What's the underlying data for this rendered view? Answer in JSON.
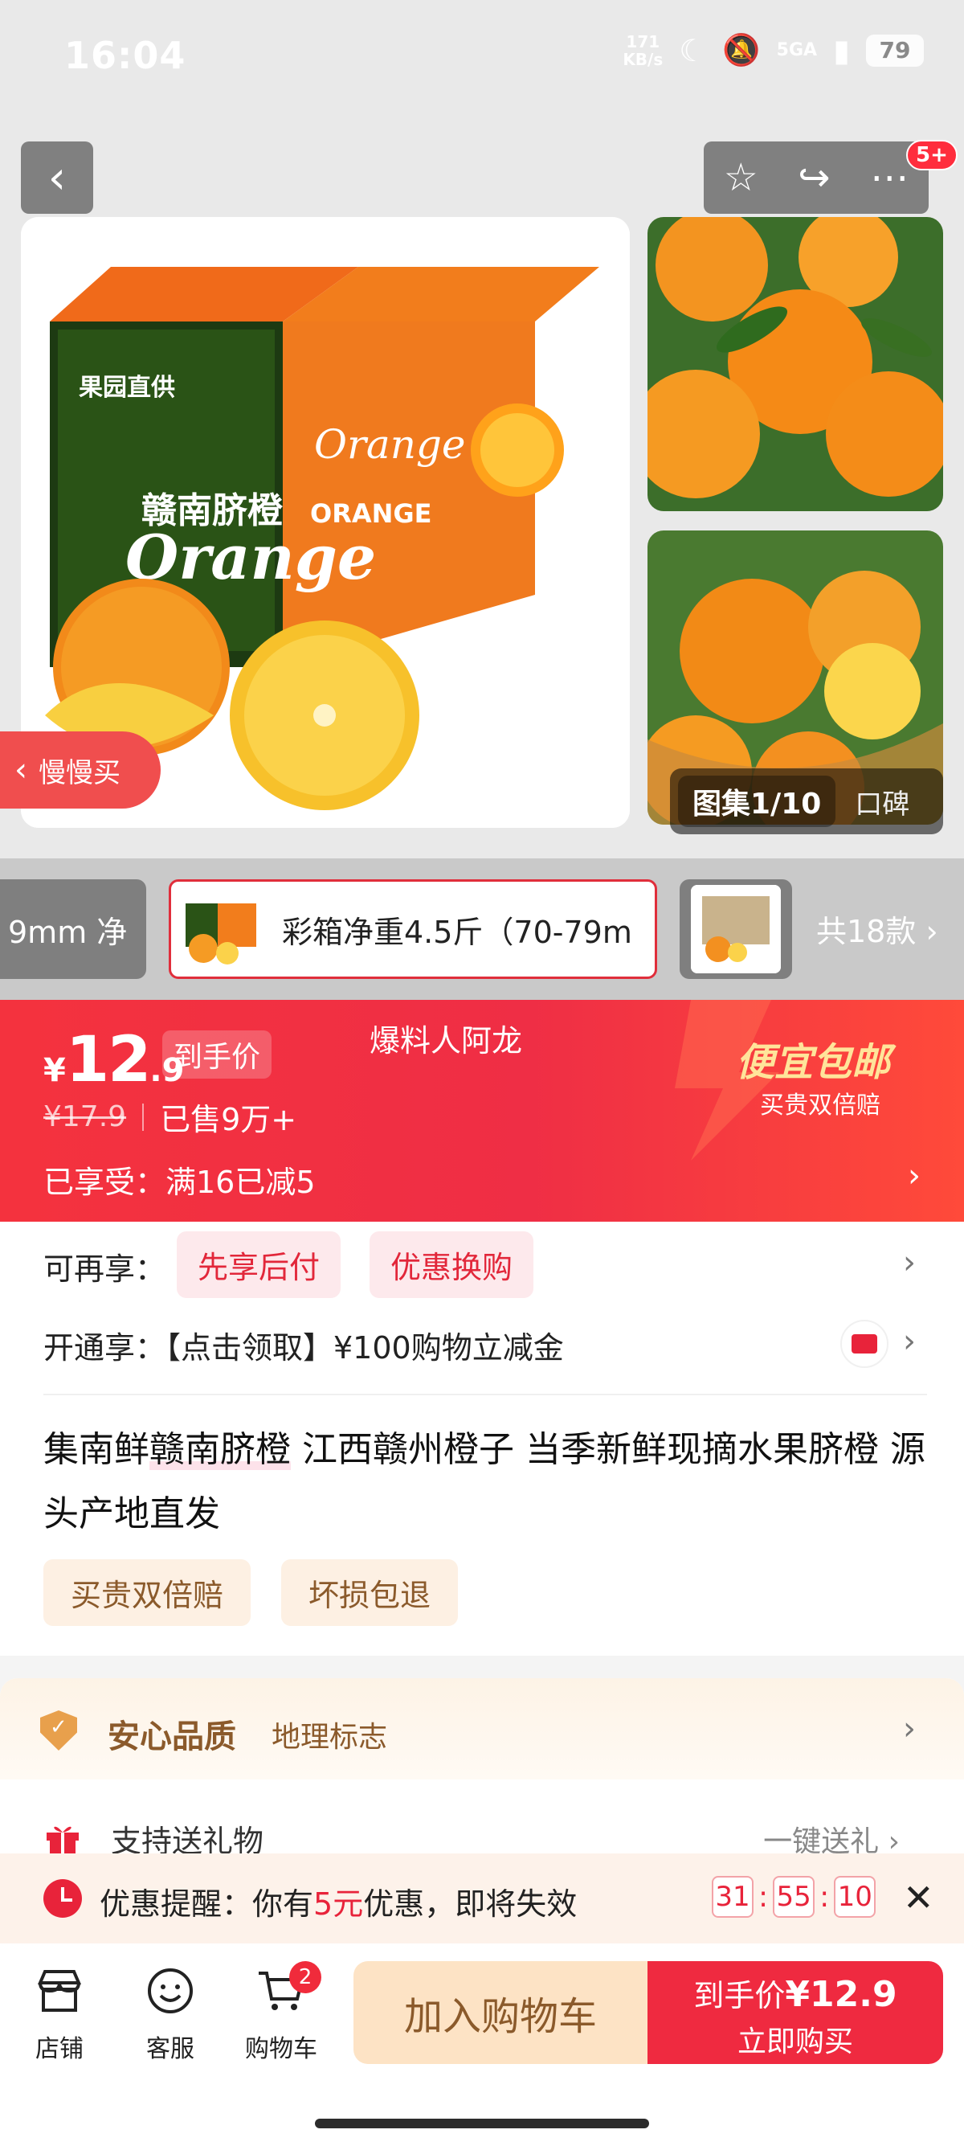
{
  "status_bar": {
    "time": "16:04",
    "net_speed_value": "171",
    "net_speed_unit": "KB/s",
    "network": "5GA",
    "battery": "79"
  },
  "header": {
    "back_icon": "chevron-left-icon",
    "badge": "5+"
  },
  "gallery": {
    "count": "图集1/10",
    "reviews": "口碑"
  },
  "slow_buy": "慢慢买",
  "product_box": {
    "brand_cn": "赣南脐橙",
    "brand_en": "Orange",
    "side_label": "ORANGE",
    "left_badge_top": "果园直供"
  },
  "variants": {
    "prev_label": "9mm 净",
    "selected_label": "彩箱净重4.5斤（70-79m",
    "total": "共18款"
  },
  "price": {
    "yen": "¥",
    "integer": "12",
    "decimal": ".9",
    "tag": "到手价",
    "reporter": "爆料人阿龙",
    "original": "¥17.9",
    "sold": "已售9万+",
    "enjoyed": "已享受：满16已减5",
    "promo_title": "便宜包邮",
    "promo_sub": "买贵双倍赔"
  },
  "benefits": {
    "more_label": "可再享：",
    "chips": [
      "先享后付",
      "优惠换购"
    ],
    "open_label": "开通享：【点击领取】¥100购物立减金"
  },
  "title": {
    "prefix": "集南鲜",
    "highlight": "赣南脐橙",
    "rest": " 江西赣州橙子 当季新鲜现摘水果脐橙 源头产地直发"
  },
  "service_tags": [
    "买贵双倍赔",
    "坏损包退"
  ],
  "quality": {
    "title": "安心品质",
    "sub": "地理标志"
  },
  "gift": {
    "label": "支持送礼物",
    "action": "一键送礼"
  },
  "reminder": {
    "prefix": "优惠提醒：你有",
    "amount": "5元",
    "suffix": "优惠，即将失效",
    "timer": [
      "31",
      "55",
      "10"
    ]
  },
  "bottom": {
    "tabs": [
      "店铺",
      "客服",
      "购物车"
    ],
    "cart_count": "2",
    "add_cart": "加入购物车",
    "buy_price_label": "到手价",
    "buy_price": "¥12.9",
    "buy_now": "立即购买"
  },
  "colors": {
    "accent_red": "#ef2a40",
    "gold": "#8b5a2b",
    "orange": "#f27d1c"
  }
}
